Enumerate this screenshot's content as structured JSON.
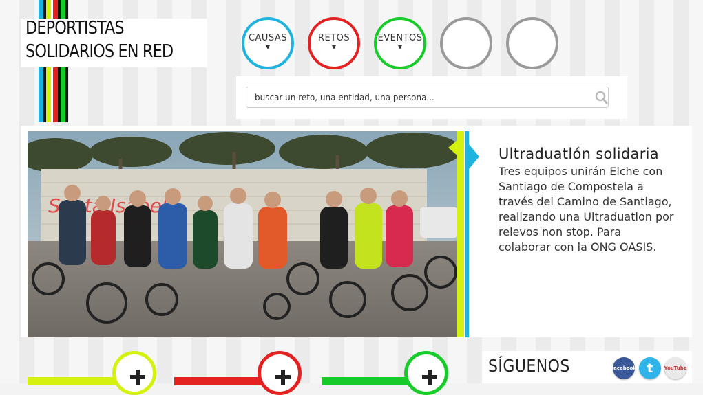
{
  "logo": {
    "line1": "DEPORTISTAS",
    "line2": "SOLIDARIOS EN RED"
  },
  "nav": {
    "items": [
      {
        "label": "CAUSAS",
        "color": "#1fb3e0"
      },
      {
        "label": "RETOS",
        "color": "#e52222"
      },
      {
        "label": "EVENTOS",
        "color": "#17cc2a"
      },
      {
        "label": "",
        "color": "#9a9a9a"
      },
      {
        "label": "",
        "color": "#9a9a9a"
      }
    ]
  },
  "search": {
    "placeholder": "buscar un reto, una entidad, una persona..."
  },
  "feature": {
    "title": "Ultraduatlón solidaria",
    "description": "Tres equipos unirán Elche con Santiago de Compostela a través del Camino de Santiago, realizando una Ultraduatlon por relevos non stop. Para colaborar con la ONG OASIS.",
    "photo_graffiti": "Santa Isabel"
  },
  "social": {
    "title": "SÍGUENOS",
    "facebook": "facebook",
    "twitter": "t",
    "youtube": "YouTube"
  },
  "colors": {
    "blue": "#1fb3e0",
    "red": "#e52222",
    "green": "#17cc2a",
    "lime": "#d4f20e"
  }
}
